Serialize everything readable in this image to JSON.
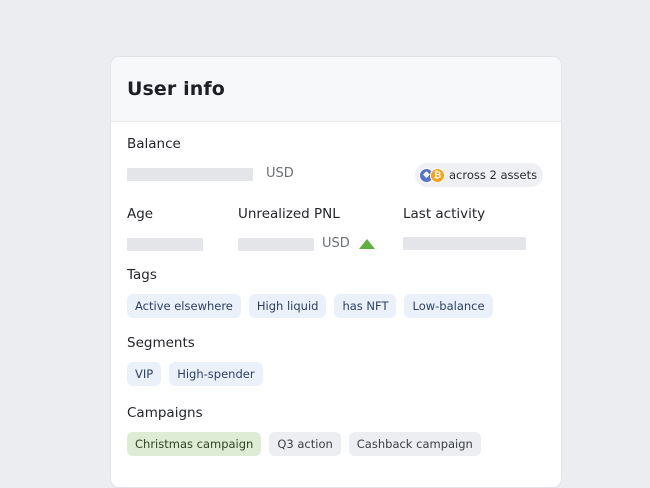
{
  "card": {
    "title": "User info"
  },
  "balance": {
    "label": "Balance",
    "unit": "USD",
    "assets": {
      "icons": [
        "ethereum-icon",
        "bitcoin-icon"
      ],
      "eth_glyph": "◆",
      "btc_glyph": "₿",
      "text": "across 2 assets"
    }
  },
  "stats": {
    "age_label": "Age",
    "pnl_label": "Unrealized PNL",
    "pnl_unit": "USD",
    "pnl_trend": "up",
    "last_activity_label": "Last activity"
  },
  "tags": {
    "label": "Tags",
    "items": [
      "Active elsewhere",
      "High liquid",
      "has NFT",
      "Low-balance"
    ]
  },
  "segments": {
    "label": "Segments",
    "items": [
      "VIP",
      "High-spender"
    ]
  },
  "campaigns": {
    "label": "Campaigns",
    "items": [
      "Christmas campaign",
      "Q3 action",
      "Cashback campaign"
    ]
  },
  "colors": {
    "background": "#ebedf1",
    "trend_up": "#5fb043",
    "tag_chip": "#eaf1fb",
    "active_campaign_chip": "#deecd6",
    "inactive_campaign_chip": "#eceef1",
    "eth": "#5474c9",
    "btc": "#f5a31a"
  }
}
